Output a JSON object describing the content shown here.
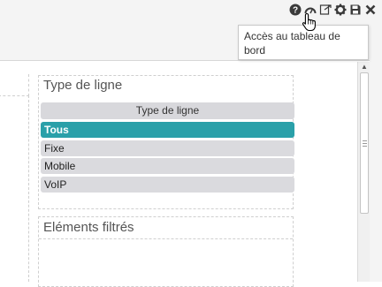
{
  "toolbar": {
    "icons": [
      "help-icon",
      "dashboard-gauge-icon",
      "export-icon",
      "settings-gear-icon",
      "save-icon",
      "close-icon"
    ]
  },
  "tooltip": {
    "text": "Accès au tableau de bord"
  },
  "filter_panel": {
    "title": "Type de ligne",
    "list_header": "Type de ligne",
    "options": [
      {
        "label": "Tous",
        "selected": true
      },
      {
        "label": "Fixe",
        "selected": false
      },
      {
        "label": "Mobile",
        "selected": false
      },
      {
        "label": "VoIP",
        "selected": false
      }
    ]
  },
  "elements_panel": {
    "title": "Eléments filtrés"
  },
  "colors": {
    "accent": "#2aa0a9",
    "option_bg": "#dadade"
  }
}
